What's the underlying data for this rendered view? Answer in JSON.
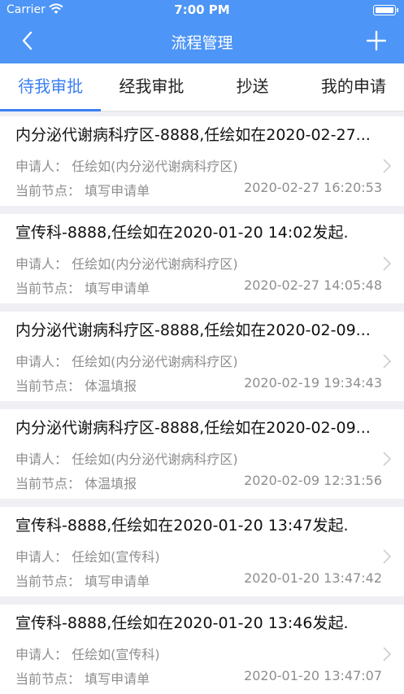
{
  "status_bar": {
    "carrier": "Carrier",
    "time": "7:00 PM"
  },
  "nav": {
    "title": "流程管理",
    "back_icon": "chevron-left-icon",
    "add_icon": "plus-icon"
  },
  "tabs": [
    {
      "label": "待我审批",
      "active": true
    },
    {
      "label": "经我审批",
      "active": false
    },
    {
      "label": "抄送",
      "active": false
    },
    {
      "label": "我的申请",
      "active": false
    }
  ],
  "colors": {
    "header": "#4d95f6",
    "accent": "#3b7ff2",
    "background": "#efeff4"
  },
  "items": [
    {
      "title": "内分泌代谢病科疗区-8888,任绘如在2020-02-27...",
      "applicant": "申请人：  任绘如(内分泌代谢病科疗区)",
      "node": "当前节点：  填写申请单",
      "time": "2020-02-27 16:20:53"
    },
    {
      "title": "宣传科-8888,任绘如在2020-01-20 14:02发起.",
      "applicant": "申请人：  任绘如(内分泌代谢病科疗区)",
      "node": "当前节点：  填写申请单",
      "time": "2020-02-27 14:05:48"
    },
    {
      "title": "内分泌代谢病科疗区-8888,任绘如在2020-02-09...",
      "applicant": "申请人：  任绘如(内分泌代谢病科疗区)",
      "node": "当前节点：  体温填报",
      "time": "2020-02-19 19:34:43"
    },
    {
      "title": "内分泌代谢病科疗区-8888,任绘如在2020-02-09...",
      "applicant": "申请人：  任绘如(内分泌代谢病科疗区)",
      "node": "当前节点：  体温填报",
      "time": "2020-02-09 12:31:56"
    },
    {
      "title": "宣传科-8888,任绘如在2020-01-20 13:47发起.",
      "applicant": "申请人：  任绘如(宣传科)",
      "node": "当前节点：  填写申请单",
      "time": "2020-01-20 13:47:42"
    },
    {
      "title": "宣传科-8888,任绘如在2020-01-20 13:46发起.",
      "applicant": "申请人：  任绘如(宣传科)",
      "node": "当前节点：  填写申请单",
      "time": "2020-01-20 13:47:07"
    }
  ]
}
